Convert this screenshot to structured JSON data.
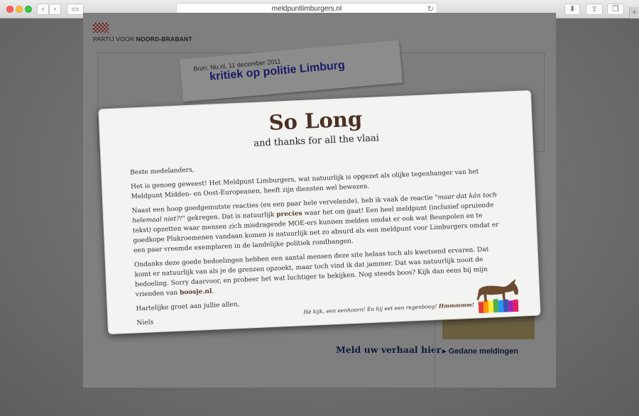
{
  "browser": {
    "url": "meldpuntlimburgers.nl",
    "sidebar_icon": "sidebar-icon",
    "download_icon": "download-icon",
    "share_icon": "share-icon",
    "tabs_icon": "tabs-icon",
    "plus": "+"
  },
  "site": {
    "brand_prefix": "PARTIJ VOOR",
    "brand_name": "NOORD-BRABANT",
    "clipping_source": "Bron: Nu.nl, 11 december 2011",
    "clipping_headline": "kritiek op politie Limburg",
    "story_link": "Meld uw verhaal hier",
    "sidebar_link": "Gedane meldingen"
  },
  "modal": {
    "title": "So Long",
    "subtitle": "and thanks for all the vlaai",
    "greeting": "Beste medelanders,",
    "p1": "Het is genoeg geweest! Het Meldpunt Limburgers, wat natuurlijk is opgezet als olijke tegenhanger van het Meldpunt Midden- en Oost-Europeanen, heeft zijn diensten wel bewezen.",
    "p2a": "Naast een hoop goedgemutste reacties (en een paar hele vervelende), heb ik vaak de reactie ",
    "p2_quote": "\"maar dat kán toch helemaal niet?!\"",
    "p2b": " gekregen. Dat is natuurlijk ",
    "p2_precies": "precies",
    "p2c": " waar het om gaat! Een heel meldpunt (inclusief opruiende tekst) opzetten waar mensen zich misdragende MOE-ers kunnen melden omdat er ook wat Beunpolen en te goedkope Plukroemenen vandaan komen is natuurlijk net zo absurd als een meldpunt voor Limburgers omdat er een paar vreemde exemplaren in de landelijke politiek rondhangen.",
    "p3a": "Ondanks deze goede bedoelingen hebben een aantal mensen deze site helaas toch als kwetsend ervaren. Dat komt er natuurlijk van als je de grenzen opzoekt, maar toch vind ik dat jammer. Dat was natuurlijk nooit de bedoeling. Sorry daarvoor, en probeer het wat luchtiger te bekijken. Nog steeds boos? Kijk dan eens bij mijn vrienden van ",
    "p3_link": "boosje.nl",
    "p3b": ".",
    "closing": "Hartelijke groet aan jullie allen,",
    "signature": "Niels",
    "footnote": "Hé kijk, een eenhoorn! En hij eet een regenboog!",
    "footnote_bold": "Hmmmmm!"
  }
}
